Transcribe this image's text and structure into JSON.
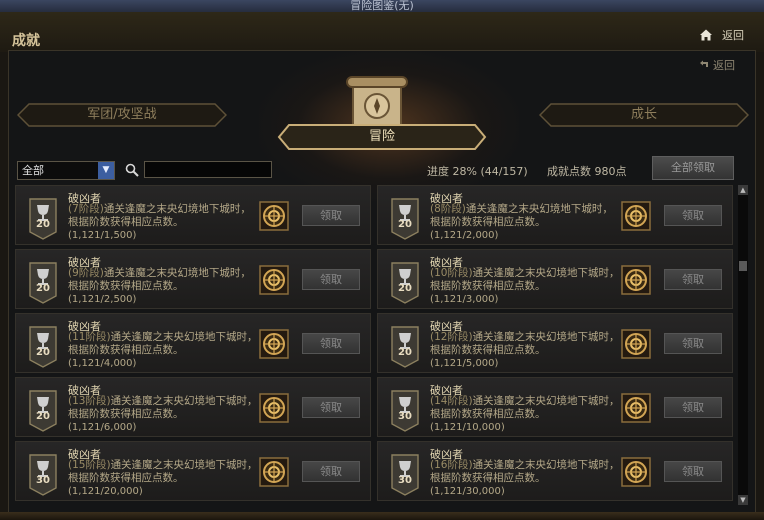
{
  "window": {
    "title": "冒险图鉴(无)"
  },
  "header": {
    "title": "成就",
    "back_label": "返回"
  },
  "panel": {
    "back_label": "返回"
  },
  "tabs": {
    "left": "军团/攻坚战",
    "active": "冒险",
    "right": "成长"
  },
  "filter": {
    "selected": "全部",
    "search_value": ""
  },
  "stats": {
    "progress": "进度  28% (44/157)",
    "points": "成就点数 980点",
    "claim_all": "全部领取"
  },
  "achievements": [
    {
      "title": "破凶者",
      "level": "(7阶段)",
      "desc": "通关逢魔之末央幻境地下城时，根据阶数获得相应点数。",
      "progress": "(1,121/1,500)",
      "badge": "20",
      "claim": "领取"
    },
    {
      "title": "破凶者",
      "level": "(8阶段)",
      "desc": "通关逢魔之末央幻境地下城时，根据阶数获得相应点数。",
      "progress": "(1,121/2,000)",
      "badge": "20",
      "claim": "领取"
    },
    {
      "title": "破凶者",
      "level": "(9阶段)",
      "desc": "通关逢魔之末央幻境地下城时，根据阶数获得相应点数。",
      "progress": "(1,121/2,500)",
      "badge": "20",
      "claim": "领取"
    },
    {
      "title": "破凶者",
      "level": "(10阶段)",
      "desc": "通关逢魔之末央幻境地下城时，根据阶数获得相应点数。",
      "progress": "(1,121/3,000)",
      "badge": "20",
      "claim": "领取"
    },
    {
      "title": "破凶者",
      "level": "(11阶段)",
      "desc": "通关逢魔之末央幻境地下城时，根据阶数获得相应点数。",
      "progress": "(1,121/4,000)",
      "badge": "20",
      "claim": "领取"
    },
    {
      "title": "破凶者",
      "level": "(12阶段)",
      "desc": "通关逢魔之末央幻境地下城时，根据阶数获得相应点数。",
      "progress": "(1,121/5,000)",
      "badge": "20",
      "claim": "领取"
    },
    {
      "title": "破凶者",
      "level": "(13阶段)",
      "desc": "通关逢魔之末央幻境地下城时，根据阶数获得相应点数。",
      "progress": "(1,121/6,000)",
      "badge": "20",
      "claim": "领取"
    },
    {
      "title": "破凶者",
      "level": "(14阶段)",
      "desc": "通关逢魔之末央幻境地下城时，根据阶数获得相应点数。",
      "progress": "(1,121/10,000)",
      "badge": "30",
      "claim": "领取"
    },
    {
      "title": "破凶者",
      "level": "(15阶段)",
      "desc": "通关逢魔之末央幻境地下城时，根据阶数获得相应点数。",
      "progress": "(1,121/20,000)",
      "badge": "30",
      "claim": "领取"
    },
    {
      "title": "破凶者",
      "level": "(16阶段)",
      "desc": "通关逢魔之末央幻境地下城时，根据阶数获得相应点数。",
      "progress": "(1,121/30,000)",
      "badge": "30",
      "claim": "领取"
    }
  ],
  "icons": {
    "home": "home-icon",
    "back": "back-arrow-icon",
    "search": "search-icon",
    "badge": "trophy-icon",
    "reward": "reward-emblem-icon",
    "dropdown": "chevron-down-icon"
  },
  "colors": {
    "accent": "#c8b98f",
    "panel_bg": "#141516",
    "dropdown": "#3c5ea0"
  }
}
